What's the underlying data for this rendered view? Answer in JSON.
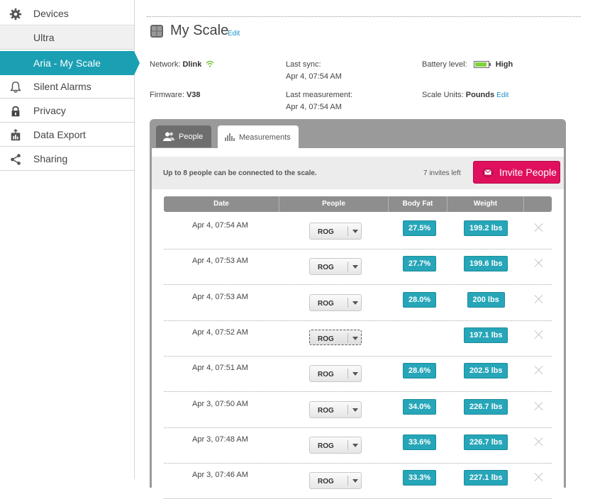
{
  "sidebar": {
    "items": [
      {
        "label": "Devices",
        "icon": "gear-icon"
      },
      {
        "label": "Ultra"
      },
      {
        "label": "Aria - My Scale"
      },
      {
        "label": "Silent Alarms",
        "icon": "bell-icon"
      },
      {
        "label": "Privacy",
        "icon": "lock-icon"
      },
      {
        "label": "Data Export",
        "icon": "chart-export-icon"
      },
      {
        "label": "Sharing",
        "icon": "share-icon"
      }
    ]
  },
  "header": {
    "title": "My Scale",
    "edit_label": "Edit"
  },
  "info": {
    "network_label": "Network:",
    "network_value": "Dlink",
    "last_sync_label": "Last sync:",
    "last_sync_value": "Apr 4, 07:54 AM",
    "battery_label": "Battery level:",
    "battery_value": "High",
    "battery_level": 0.9,
    "firmware_label": "Firmware:",
    "firmware_value": "V38",
    "last_measurement_label": "Last measurement:",
    "last_measurement_value": "Apr 4, 07:54 AM",
    "units_label": "Scale Units:",
    "units_value": "Pounds",
    "units_edit_label": "Edit"
  },
  "tabs": {
    "people": "People",
    "measurements": "Measurements"
  },
  "notice": {
    "text": "Up to 8 people can be connected to the scale.",
    "invites_left": "7 invites left",
    "invite_button": "Invite People"
  },
  "table": {
    "headers": [
      "Date",
      "People",
      "Body Fat",
      "Weight"
    ],
    "rows": [
      {
        "date": "Apr 4, 07:54 AM",
        "person": "ROG",
        "body_fat": "27.5%",
        "weight": "199.2 lbs"
      },
      {
        "date": "Apr 4, 07:53 AM",
        "person": "ROG",
        "body_fat": "27.7%",
        "weight": "199.6 lbs"
      },
      {
        "date": "Apr 4, 07:53 AM",
        "person": "ROG",
        "body_fat": "28.0%",
        "weight": "200 lbs"
      },
      {
        "date": "Apr 4, 07:52 AM",
        "person": "ROG",
        "body_fat": "",
        "weight": "197.1 lbs"
      },
      {
        "date": "Apr 4, 07:51 AM",
        "person": "ROG",
        "body_fat": "28.6%",
        "weight": "202.5 lbs"
      },
      {
        "date": "Apr 3, 07:50 AM",
        "person": "ROG",
        "body_fat": "34.0%",
        "weight": "226.7 lbs"
      },
      {
        "date": "Apr 3, 07:48 AM",
        "person": "ROG",
        "body_fat": "33.6%",
        "weight": "226.7 lbs"
      },
      {
        "date": "Apr 3, 07:46 AM",
        "person": "ROG",
        "body_fat": "33.3%",
        "weight": "227.1 lbs"
      }
    ]
  },
  "colors": {
    "accent": "#1a9fb3",
    "badge": "#26a6b8",
    "invite": "#e0105f",
    "battery_fill": "#7fd23a"
  }
}
